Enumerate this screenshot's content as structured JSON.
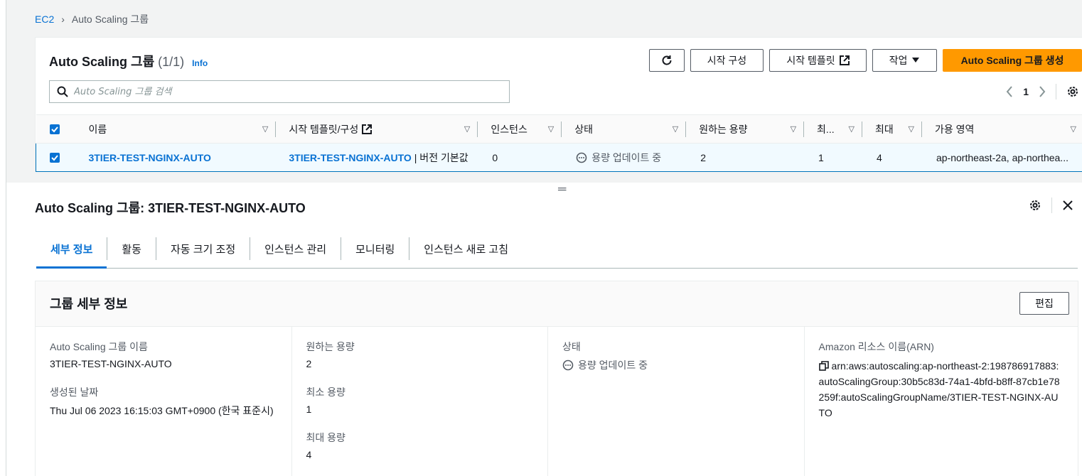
{
  "breadcrumb": {
    "root": "EC2",
    "separator": "›",
    "current": "Auto Scaling 그룹"
  },
  "list": {
    "title": "Auto Scaling 그룹",
    "count": "(1/1)",
    "info": "Info",
    "buttons": {
      "refresh_icon": "refresh-icon",
      "launch_config": "시작 구성",
      "launch_templates": "시작 템플릿",
      "actions": "작업",
      "create": "Auto Scaling 그룹 생성"
    },
    "search_placeholder": "Auto Scaling 그룹 검색",
    "pagination": {
      "current_page": "1"
    },
    "columns": [
      "이름",
      "시작 템플릿/구성",
      "인스턴스",
      "상태",
      "원하는 용량",
      "최...",
      "최대",
      "가용 영역"
    ],
    "rows": [
      {
        "name": "3TIER-TEST-NGINX-AUTO",
        "template_name": "3TIER-TEST-NGINX-AUTO",
        "template_suffix": "| 버전 기본값",
        "instances": "0",
        "status": "용량 업데이트 중",
        "desired": "2",
        "min": "1",
        "max": "4",
        "azs": "ap-northeast-2a, ap-northea..."
      }
    ]
  },
  "detail": {
    "title": "Auto Scaling 그룹: 3TIER-TEST-NGINX-AUTO",
    "tabs": [
      "세부 정보",
      "활동",
      "자동 크기 조정",
      "인스턴스 관리",
      "모니터링",
      "인스턴스 새로 고침"
    ],
    "active_tab": "세부 정보",
    "section_title": "그룹 세부 정보",
    "edit": "편집",
    "fields": {
      "name_label": "Auto Scaling 그룹 이름",
      "name_value": "3TIER-TEST-NGINX-AUTO",
      "created_label": "생성된 날짜",
      "created_value": "Thu Jul 06 2023 16:15:03 GMT+0900 (한국 표준시)",
      "desired_label": "원하는 용량",
      "desired_value": "2",
      "min_label": "최소 용량",
      "min_value": "1",
      "max_label": "최대 용량",
      "max_value": "4",
      "status_label": "상태",
      "status_value": "용량 업데이트 중",
      "arn_label": "Amazon 리소스 이름(ARN)",
      "arn_value": "arn:aws:autoscaling:ap-northeast-2:198786917883:autoScalingGroup:30b5c83d-74a1-4bfd-b8ff-87cb1e78259f:autoScalingGroupName/3TIER-TEST-NGINX-AUTO"
    }
  },
  "colors": {
    "accent": "#0972d3",
    "primary_button": "#ff9900",
    "selected_row": "#f1faff"
  }
}
